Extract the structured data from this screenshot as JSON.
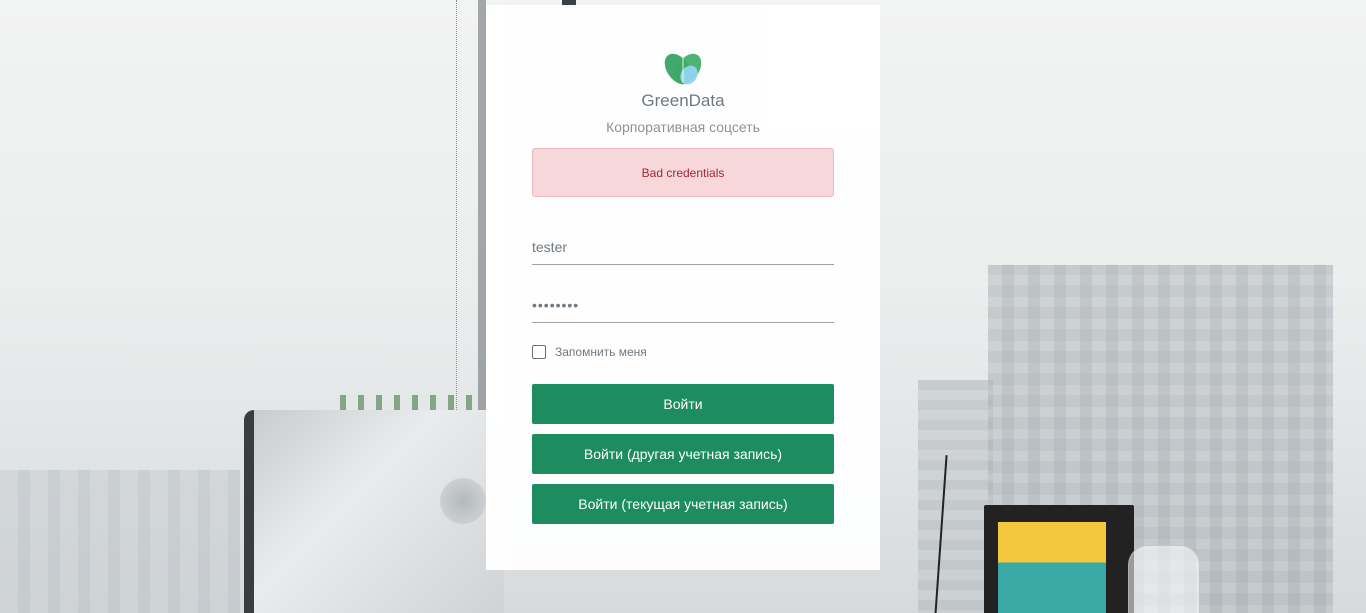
{
  "app": {
    "brand_name": "GreenData",
    "subtitle": "Корпоративная соцсеть"
  },
  "alert": {
    "message": "Bad credentials",
    "colors": {
      "background": "#f8d7da",
      "text": "#a02330"
    }
  },
  "form": {
    "username_value": "tester",
    "password_value": "••••••••",
    "remember_label": "Запомнить меня",
    "remember_checked": false
  },
  "buttons": {
    "login": "Войти",
    "login_other": "Войти (другая учетная запись)",
    "login_current": "Войти (текущая учетная запись)"
  },
  "colors": {
    "accent": "#178a5b",
    "logo_green": "#2e9e5b",
    "logo_blue": "#8fd3f0"
  },
  "icons": {
    "logo": "greendata-logo-icon"
  }
}
